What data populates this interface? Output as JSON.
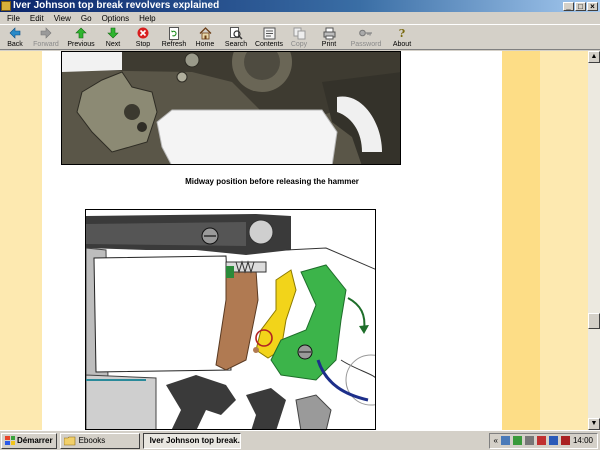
{
  "window": {
    "title": "Iver Johnson top break revolvers explained"
  },
  "menu": [
    "File",
    "Edit",
    "View",
    "Go",
    "Options",
    "Help"
  ],
  "toolbar": [
    {
      "label": "Back",
      "icon": "back-arrow-icon",
      "enabled": true
    },
    {
      "label": "Forward",
      "icon": "forward-arrow-icon",
      "enabled": false
    },
    {
      "label": "Previous",
      "icon": "up-arrow-icon",
      "enabled": true
    },
    {
      "label": "Next",
      "icon": "down-arrow-icon",
      "enabled": true
    },
    {
      "label": "Stop",
      "icon": "stop-icon",
      "enabled": true
    },
    {
      "label": "Refresh",
      "icon": "refresh-icon",
      "enabled": true
    },
    {
      "label": "Home",
      "icon": "home-icon",
      "enabled": true
    },
    {
      "label": "Search",
      "icon": "search-icon",
      "enabled": true
    },
    {
      "label": "Contents",
      "icon": "contents-icon",
      "enabled": true
    },
    {
      "label": "Copy",
      "icon": "copy-icon",
      "enabled": false
    },
    {
      "label": "Print",
      "icon": "print-icon",
      "enabled": true
    },
    {
      "label": "Password",
      "icon": "key-icon",
      "enabled": false
    },
    {
      "label": "About",
      "icon": "about-icon",
      "enabled": true
    }
  ],
  "content": {
    "caption": "Midway position before releasing the hammer",
    "colors": {
      "margin": "#fde9b0",
      "accent_band": "#fddd86",
      "page": "#ffffff"
    }
  },
  "taskbar": {
    "start_label": "Démarrer",
    "tasks": [
      {
        "label": "Ebooks",
        "active": false
      },
      {
        "label": "Iver Johnson top break...",
        "active": true
      }
    ],
    "tray_prefix": "«",
    "clock": "14:00"
  }
}
